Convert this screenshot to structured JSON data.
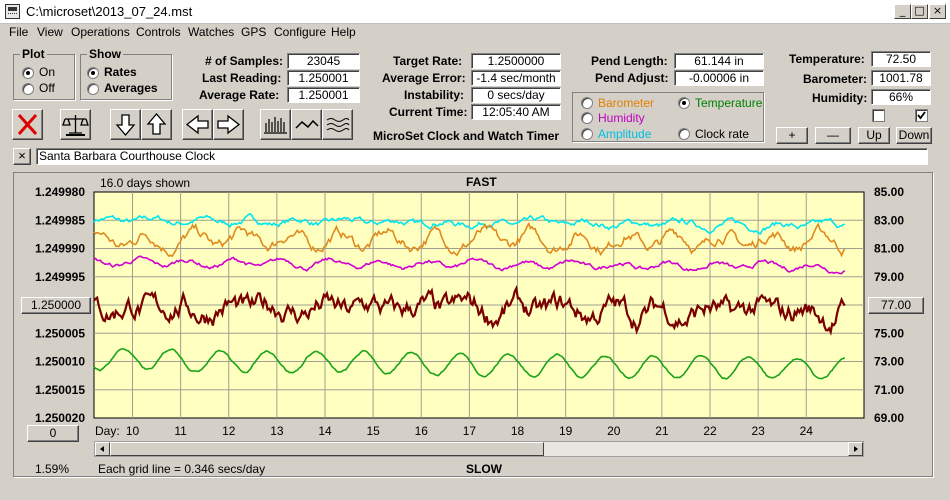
{
  "window": {
    "title": "C:\\microset\\2013_07_24.mst",
    "controls": [
      "_",
      "□",
      "×"
    ]
  },
  "menu": [
    "File",
    "View",
    "Operations",
    "Controls",
    "Watches",
    "GPS",
    "Configure",
    "Help"
  ],
  "plot_group": {
    "title": "Plot",
    "options": [
      "On",
      "Off"
    ],
    "selected": "On"
  },
  "show_group": {
    "title": "Show",
    "options": [
      "Rates",
      "Averages"
    ],
    "selected": "Rates"
  },
  "stats": {
    "samples_label": "# of Samples:",
    "samples": "23045",
    "last_label": "Last Reading:",
    "last": "1.250001",
    "avg_label": "Average Rate:",
    "avg": "1.250001"
  },
  "rates": {
    "target_label": "Target Rate:",
    "target": "1.2500000",
    "error_label": "Average Error:",
    "error": "-1.4 sec/month",
    "instab_label": "Instability:",
    "instab": "0 secs/day",
    "time_label": "Current Time:",
    "time": "12:05:40 AM"
  },
  "pend": {
    "length_label": "Pend Length:",
    "length": "61.144 in",
    "adjust_label": "Pend Adjust:",
    "adjust": "-0.00006 in"
  },
  "env": {
    "temp_label": "Temperature:",
    "temp": "72.50",
    "baro_label": "Barometer:",
    "baro": "1001.78",
    "hum_label": "Humidity:",
    "hum": "66%"
  },
  "series_select": {
    "barometer": {
      "label": "Barometer",
      "color": "#e08000"
    },
    "temperature": {
      "label": "Temperature",
      "color": "#008000"
    },
    "humidity": {
      "label": "Humidity",
      "color": "#c000c0"
    },
    "amplitude": {
      "label": "Amplitude",
      "color": "#00c0e0"
    },
    "clockrate": {
      "label": "Clock rate",
      "color": "#000000"
    },
    "selected": "Temperature"
  },
  "scale_buttons": {
    "plus": "+",
    "minus": "—",
    "up": "Up",
    "down": "Down"
  },
  "app_caption": "MicroSet Clock and Watch Timer",
  "clock_name": "Santa Barbara Courthouse Clock",
  "close_x": "×",
  "chart_data": {
    "type": "line",
    "top_label": "FAST",
    "bottom_label": "SLOW",
    "days_shown": "16.0 days shown",
    "grid_info": "Each grid line = 0.346 secs/day",
    "percent": "1.59%",
    "x_prefix": "Day:",
    "x_ticks": [
      "10",
      "11",
      "12",
      "13",
      "14",
      "15",
      "16",
      "17",
      "18",
      "19",
      "20",
      "21",
      "22",
      "23",
      "24"
    ],
    "xlim": [
      9.2,
      25.2
    ],
    "left_ticks": [
      "1.249980",
      "1.249985",
      "1.249990",
      "1.249995",
      "1.250000",
      "1.250005",
      "1.250010",
      "1.250015",
      "1.250020"
    ],
    "right_ticks": [
      "85.00",
      "83.00",
      "81.00",
      "79.00",
      "77.00",
      "75.00",
      "73.00",
      "71.00",
      "69.00"
    ],
    "left_ylim": [
      1.24998,
      1.25002
    ],
    "right_ylim": [
      69,
      85
    ],
    "center_left": "1.250000",
    "center_right": "77.00",
    "x_offset_button": "0",
    "series": [
      {
        "name": "Amplitude",
        "color": "#00e5ee",
        "base": 83.0,
        "noise": 0.25,
        "wave": 0.15,
        "trend": -0.4
      },
      {
        "name": "Barometer",
        "color": "#e08a1e",
        "base": 81.6,
        "noise": 0.45,
        "wave": 0.5,
        "trend": 0.0
      },
      {
        "name": "Humidity",
        "color": "#d000d0",
        "base": 80.0,
        "noise": 0.18,
        "wave": 0.25,
        "trend": -0.3
      },
      {
        "name": "Clock rate",
        "color": "#7a0000",
        "base": 76.8,
        "noise": 0.9,
        "wave": 0.3,
        "trend": -0.4
      },
      {
        "name": "Temperature",
        "color": "#1aa31a",
        "base": 73.2,
        "noise": 0.1,
        "wave": 0.75,
        "trend": -0.8
      }
    ]
  }
}
